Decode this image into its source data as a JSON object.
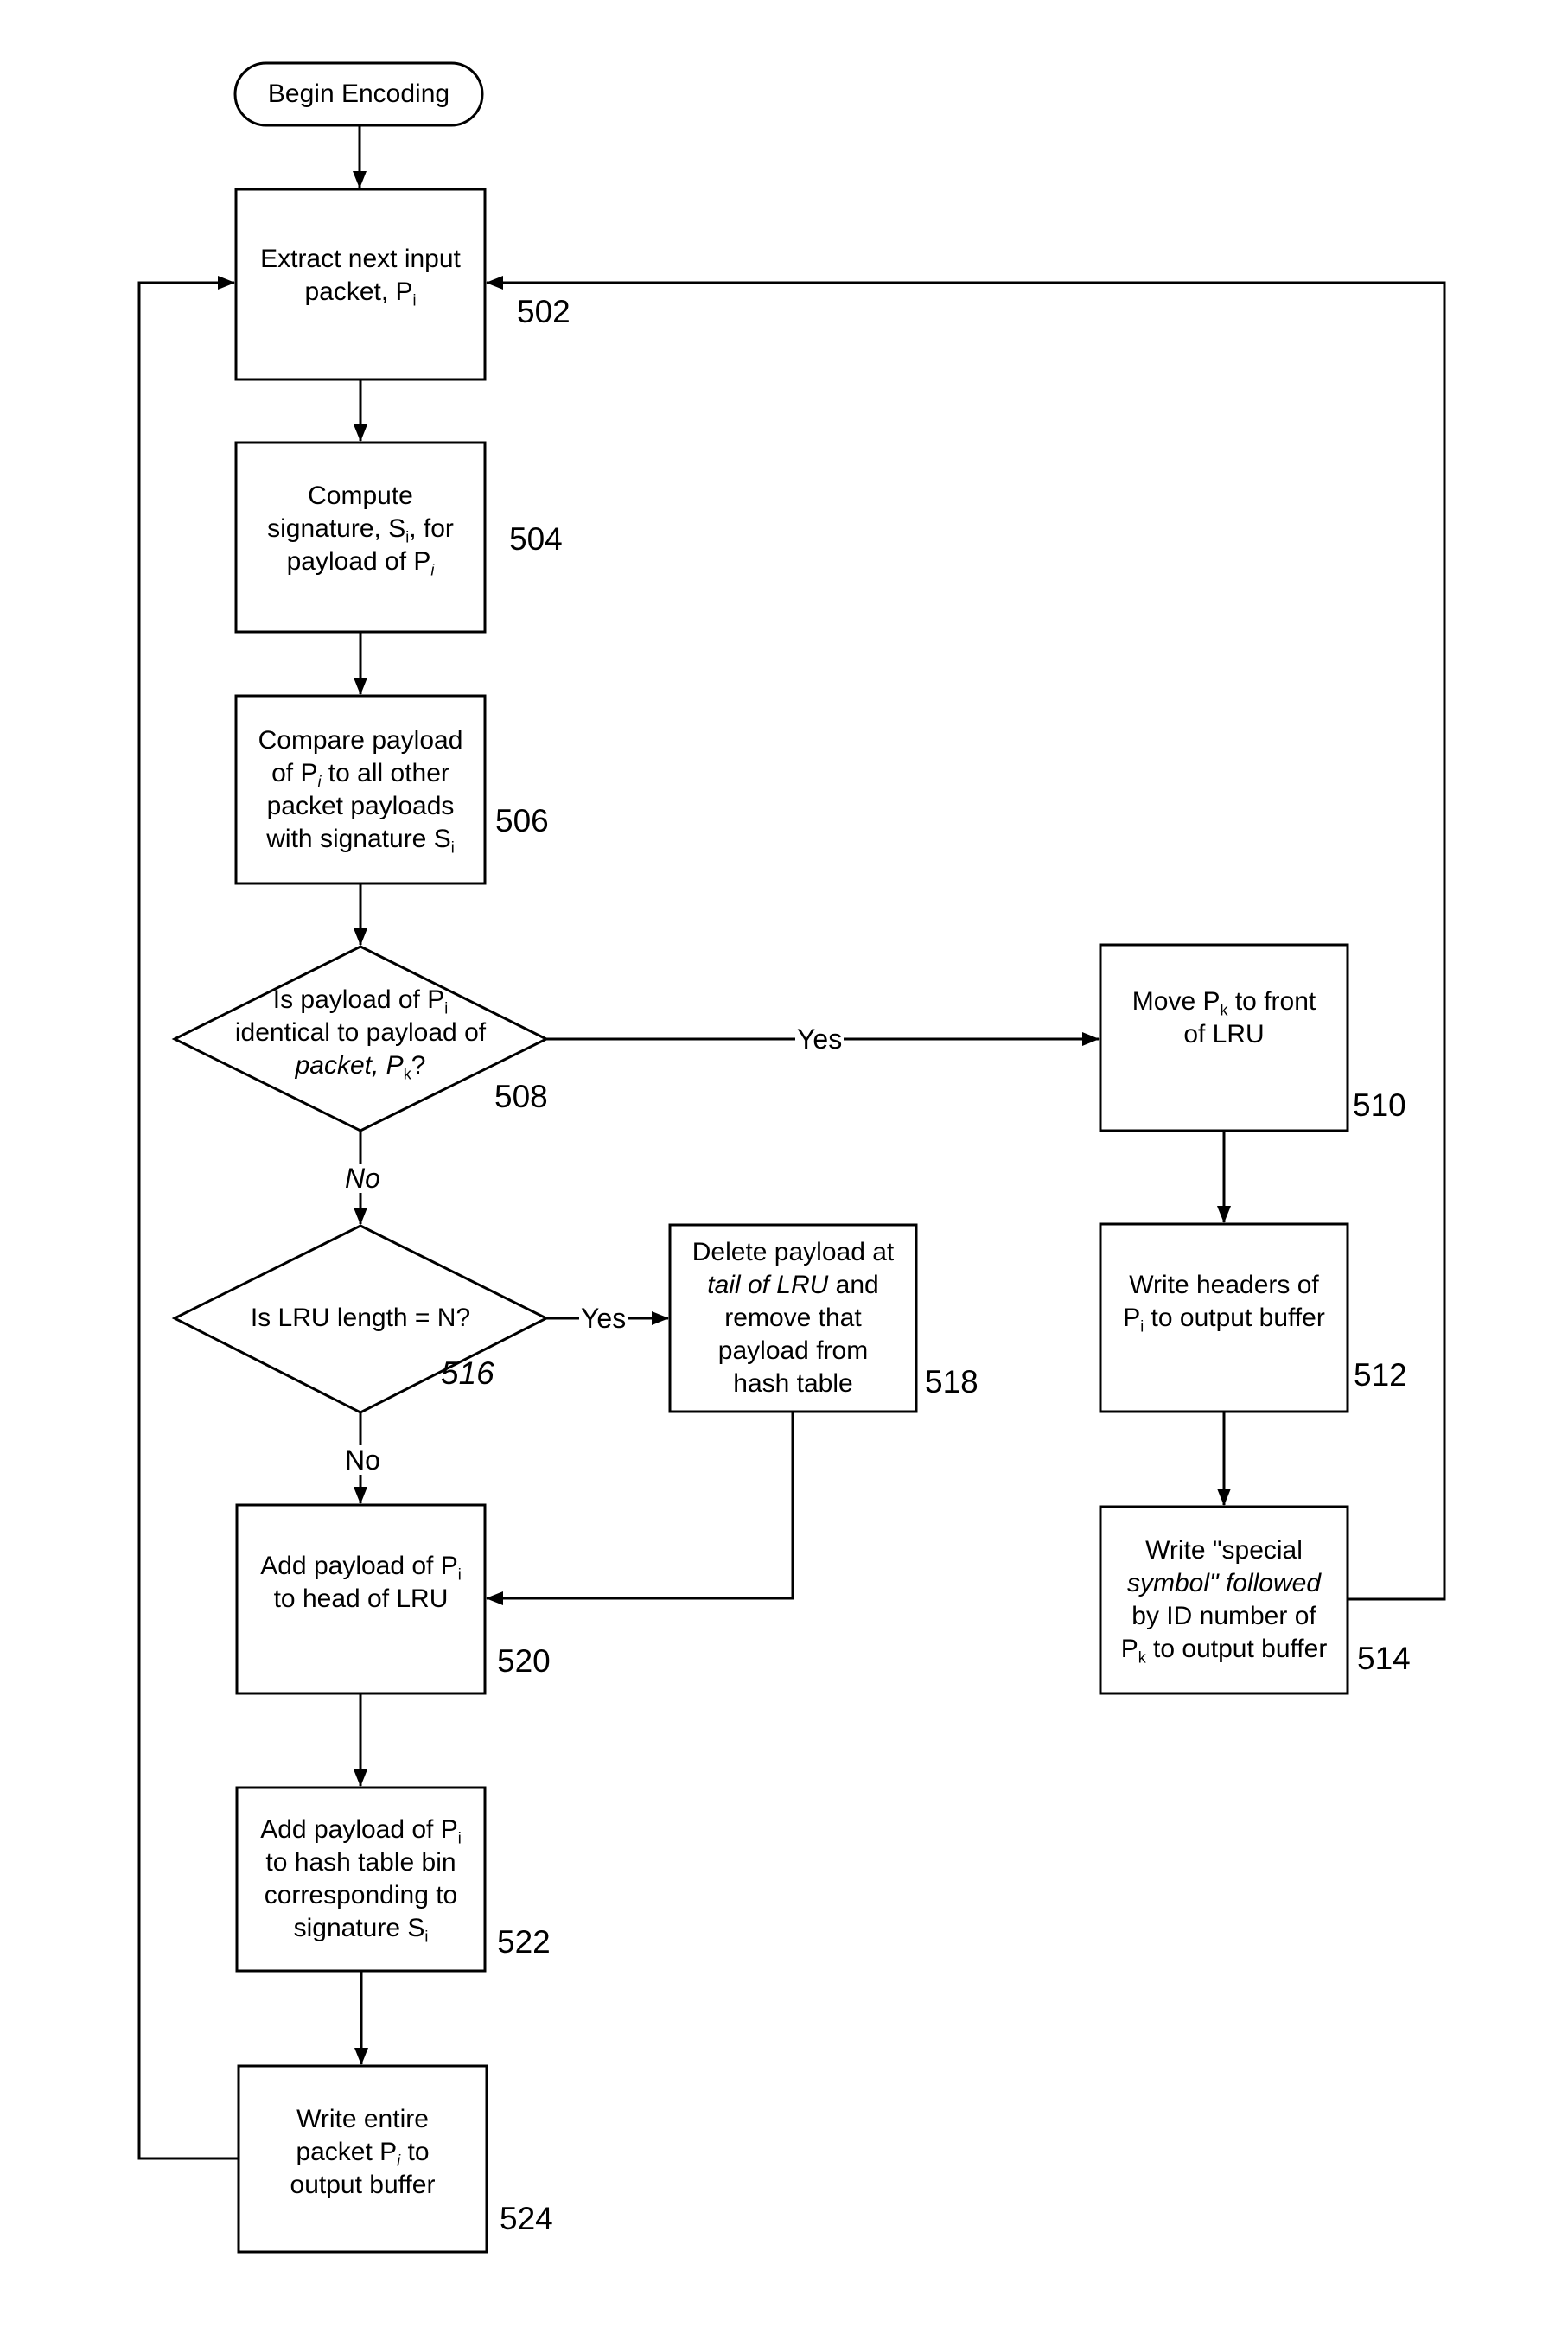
{
  "diagram": {
    "type": "flowchart",
    "nodes": [
      {
        "id": "start",
        "shape": "terminator",
        "text": "Begin Encoding",
        "ref": ""
      },
      {
        "id": "502",
        "shape": "process",
        "lines": [
          [
            {
              "t": "Extract next input"
            }
          ],
          [
            {
              "t": "packet, P"
            },
            {
              "sub": "i"
            }
          ]
        ],
        "ref": "502"
      },
      {
        "id": "504",
        "shape": "process",
        "lines": [
          [
            {
              "t": "Compute"
            }
          ],
          [
            {
              "t": "signature, S"
            },
            {
              "sub": "i"
            },
            {
              "t": ", for"
            }
          ],
          [
            {
              "t": "payload of P"
            },
            {
              "sub": "i",
              "italic": true
            }
          ]
        ],
        "ref": "504"
      },
      {
        "id": "506",
        "shape": "process",
        "lines": [
          [
            {
              "t": "Compare payload"
            }
          ],
          [
            {
              "t": "of P"
            },
            {
              "sub": "i",
              "italic": true
            },
            {
              "t": " to all other"
            }
          ],
          [
            {
              "t": "packet payloads"
            }
          ],
          [
            {
              "t": "with signature S"
            },
            {
              "sub": "i"
            }
          ]
        ],
        "ref": "506"
      },
      {
        "id": "508",
        "shape": "decision",
        "lines": [
          [
            {
              "t": "Is payload of P"
            },
            {
              "sub": "i"
            }
          ],
          [
            {
              "t": "identical to payload of"
            }
          ],
          [
            {
              "t": "packet, P",
              "italic": true
            },
            {
              "sub": "k"
            },
            {
              "t": "?"
            }
          ]
        ],
        "ref": "508"
      },
      {
        "id": "510",
        "shape": "process",
        "lines": [
          [
            {
              "t": "Move P"
            },
            {
              "sub": "k"
            },
            {
              "t": " to front"
            }
          ],
          [
            {
              "t": "of LRU"
            }
          ]
        ],
        "ref": "510"
      },
      {
        "id": "512",
        "shape": "process",
        "lines": [
          [
            {
              "t": "Write headers of"
            }
          ],
          [
            {
              "t": "P"
            },
            {
              "sub": "i"
            },
            {
              "t": " to output buffer"
            }
          ]
        ],
        "ref": "512"
      },
      {
        "id": "514",
        "shape": "process",
        "lines": [
          [
            {
              "t": "Write \"special"
            }
          ],
          [
            {
              "t": "symbol\" followed",
              "italic": true
            }
          ],
          [
            {
              "t": "by ID number of"
            }
          ],
          [
            {
              "t": "P"
            },
            {
              "sub": "k"
            },
            {
              "t": " to output buffer"
            }
          ]
        ],
        "ref": "514"
      },
      {
        "id": "516",
        "shape": "decision",
        "lines": [
          [
            {
              "t": "Is LRU length = N?"
            }
          ]
        ],
        "ref": "516"
      },
      {
        "id": "518",
        "shape": "process",
        "lines": [
          [
            {
              "t": "Delete payload at"
            }
          ],
          [
            {
              "t": "tail of LRU",
              "italic": true
            },
            {
              "t": " and"
            }
          ],
          [
            {
              "t": "remove that"
            }
          ],
          [
            {
              "t": "payload from"
            }
          ],
          [
            {
              "t": "hash table"
            }
          ]
        ],
        "ref": "518"
      },
      {
        "id": "520",
        "shape": "process",
        "lines": [
          [
            {
              "t": "Add payload of P"
            },
            {
              "sub": "i"
            }
          ],
          [
            {
              "t": "to head of LRU"
            }
          ]
        ],
        "ref": "520"
      },
      {
        "id": "522",
        "shape": "process",
        "lines": [
          [
            {
              "t": "Add payload of P"
            },
            {
              "sub": "i"
            }
          ],
          [
            {
              "t": "to hash table bin"
            }
          ],
          [
            {
              "t": "corresponding to"
            }
          ],
          [
            {
              "t": "signature S"
            },
            {
              "sub": "i"
            }
          ]
        ],
        "ref": "522"
      },
      {
        "id": "524",
        "shape": "process",
        "lines": [
          [
            {
              "t": "Write entire"
            }
          ],
          [
            {
              "t": "packet P"
            },
            {
              "sub": "i",
              "italic": true
            },
            {
              "t": " to"
            }
          ],
          [
            {
              "t": "output buffer"
            }
          ]
        ],
        "ref": "524"
      }
    ],
    "edges": [
      {
        "from": "start",
        "to": "502",
        "label": ""
      },
      {
        "from": "502",
        "to": "504",
        "label": ""
      },
      {
        "from": "504",
        "to": "506",
        "label": ""
      },
      {
        "from": "506",
        "to": "508",
        "label": ""
      },
      {
        "from": "508",
        "to": "510",
        "label": "Yes"
      },
      {
        "from": "508",
        "to": "516",
        "label": "No"
      },
      {
        "from": "510",
        "to": "512",
        "label": ""
      },
      {
        "from": "512",
        "to": "514",
        "label": ""
      },
      {
        "from": "514",
        "to": "502",
        "label": ""
      },
      {
        "from": "516",
        "to": "518",
        "label": "Yes"
      },
      {
        "from": "516",
        "to": "520",
        "label": "No"
      },
      {
        "from": "518",
        "to": "520",
        "label": ""
      },
      {
        "from": "520",
        "to": "522",
        "label": ""
      },
      {
        "from": "522",
        "to": "524",
        "label": ""
      },
      {
        "from": "524",
        "to": "502",
        "label": ""
      }
    ]
  },
  "labels": {
    "yes_508": "Yes",
    "no_508": "No",
    "yes_516": "Yes",
    "no_516": "No"
  }
}
